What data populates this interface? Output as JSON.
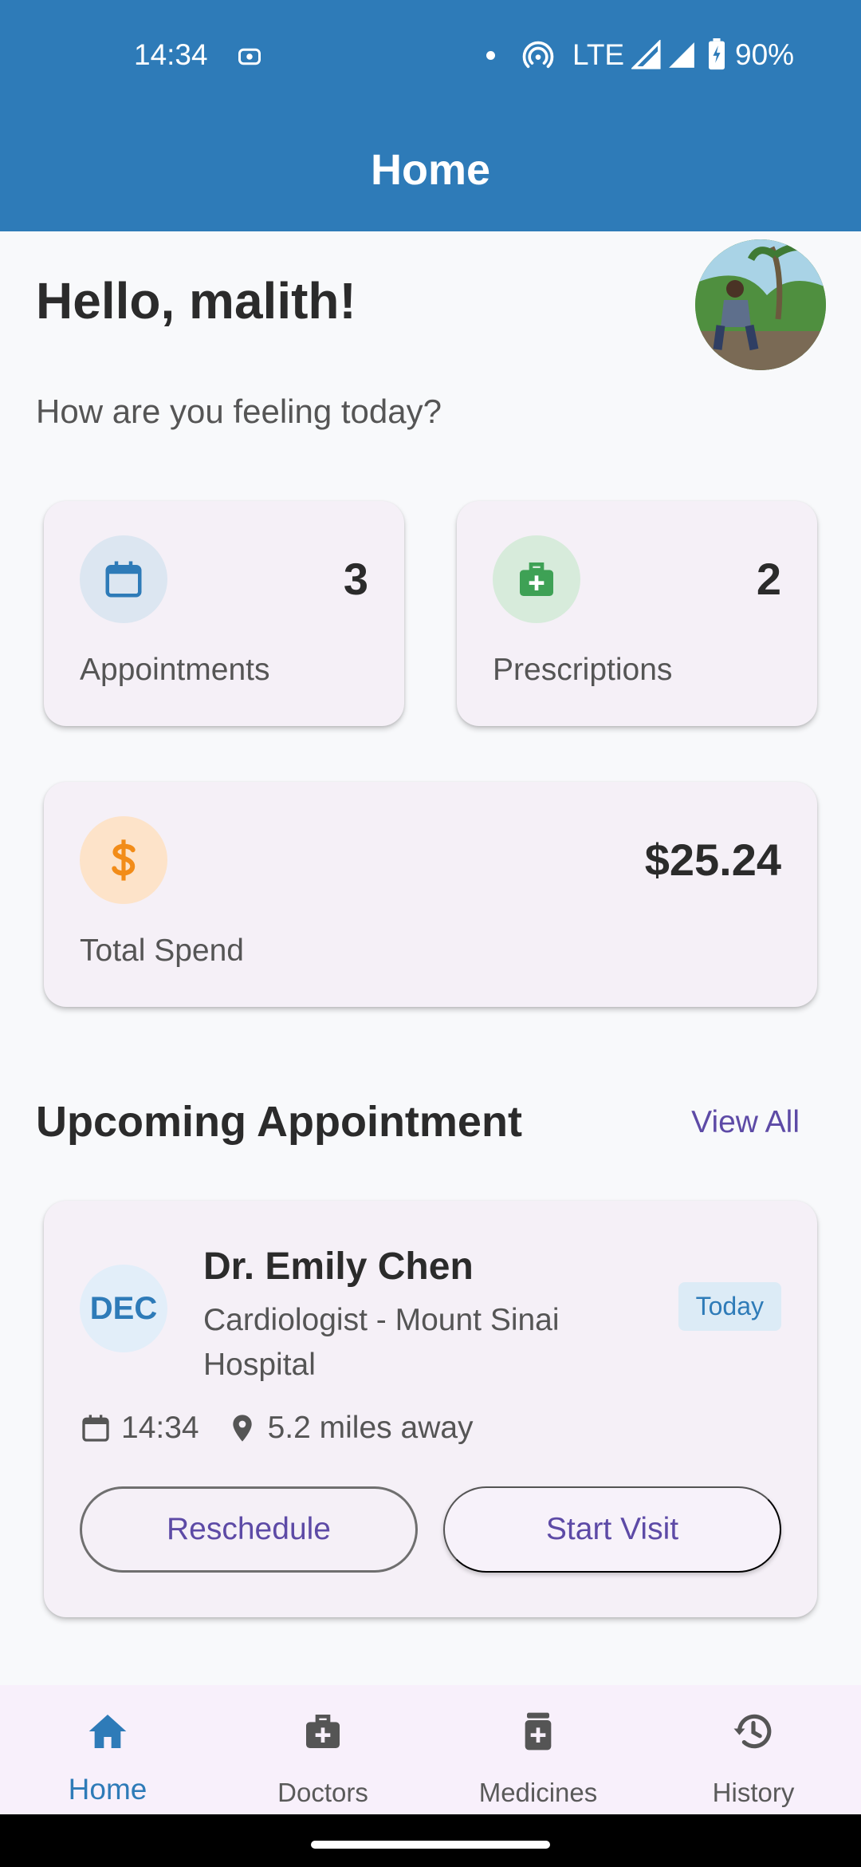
{
  "status_bar": {
    "time": "14:34",
    "network": "LTE",
    "battery": "90%"
  },
  "app_bar": {
    "title": "Home"
  },
  "greeting": {
    "hello": "Hello, malith!",
    "subtitle": "How are you feeling today?"
  },
  "stats": {
    "appointments": {
      "value": "3",
      "label": "Appointments",
      "icon": "calendar-icon",
      "color": "#2e7bb8",
      "bg": "#dce6f1"
    },
    "prescriptions": {
      "value": "2",
      "label": "Prescriptions",
      "icon": "medical-bag-icon",
      "color": "#3ea155",
      "bg": "#d7ebdb"
    },
    "spend": {
      "value": "$25.24",
      "label": "Total Spend",
      "icon": "dollar-icon",
      "color": "#f28c18",
      "bg": "#fde3c9"
    }
  },
  "upcoming": {
    "section_title": "Upcoming Appointment",
    "view_all": "View All",
    "month": "DEC",
    "doctor": "Dr. Emily Chen",
    "specialty": "Cardiologist - Mount Sinai Hospital",
    "badge": "Today",
    "time": "14:34",
    "distance": "5.2 miles away",
    "reschedule_label": "Reschedule",
    "start_label": "Start Visit"
  },
  "bottom_nav": {
    "items": [
      {
        "label": "Home",
        "icon": "home-icon",
        "active": true
      },
      {
        "label": "Doctors",
        "icon": "medical-bag-icon",
        "active": false
      },
      {
        "label": "Medicines",
        "icon": "medicine-bottle-icon",
        "active": false
      },
      {
        "label": "History",
        "icon": "history-icon",
        "active": false
      }
    ]
  },
  "colors": {
    "primary": "#2e7bb8",
    "accent_text": "#5d4aa6",
    "card_bg": "#f5f0f7"
  }
}
